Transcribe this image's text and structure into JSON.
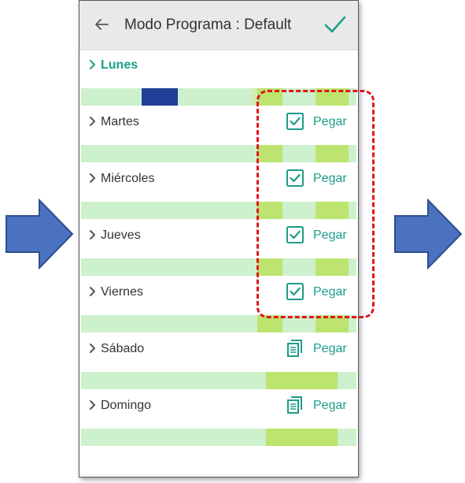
{
  "header": {
    "title": "Modo Programa : Default",
    "back_icon": "arrow-left-icon",
    "confirm_icon": "check-icon"
  },
  "days": [
    {
      "label": "Lunes",
      "active": true,
      "paste": null,
      "segments": [
        {
          "start": 0.62,
          "end": 0.72,
          "color": "#d0ecb0"
        },
        {
          "start": 0.22,
          "end": 0.35,
          "color": "#1f3f96"
        },
        {
          "start": 0.64,
          "end": 0.73,
          "color": "#bde46e"
        },
        {
          "start": 0.85,
          "end": 0.97,
          "color": "#bde46e"
        }
      ]
    },
    {
      "label": "Martes",
      "active": false,
      "paste": {
        "icon": "checkbox-checked-icon",
        "label": "Pegar"
      },
      "segments": [
        {
          "start": 0.64,
          "end": 0.73,
          "color": "#bde46e"
        },
        {
          "start": 0.85,
          "end": 0.97,
          "color": "#bde46e"
        }
      ]
    },
    {
      "label": "Miércoles",
      "active": false,
      "paste": {
        "icon": "checkbox-checked-icon",
        "label": "Pegar"
      },
      "segments": [
        {
          "start": 0.64,
          "end": 0.73,
          "color": "#bde46e"
        },
        {
          "start": 0.85,
          "end": 0.97,
          "color": "#bde46e"
        }
      ]
    },
    {
      "label": "Jueves",
      "active": false,
      "paste": {
        "icon": "checkbox-checked-icon",
        "label": "Pegar"
      },
      "segments": [
        {
          "start": 0.64,
          "end": 0.73,
          "color": "#bde46e"
        },
        {
          "start": 0.85,
          "end": 0.97,
          "color": "#bde46e"
        }
      ]
    },
    {
      "label": "Viernes",
      "active": false,
      "paste": {
        "icon": "checkbox-checked-icon",
        "label": "Pegar"
      },
      "segments": [
        {
          "start": 0.64,
          "end": 0.73,
          "color": "#bde46e"
        },
        {
          "start": 0.85,
          "end": 0.97,
          "color": "#bde46e"
        }
      ]
    },
    {
      "label": "Sábado",
      "active": false,
      "paste": {
        "icon": "copy-icon",
        "label": "Pegar"
      },
      "segments": [
        {
          "start": 0.67,
          "end": 0.93,
          "color": "#bde46e"
        }
      ]
    },
    {
      "label": "Domingo",
      "active": false,
      "paste": {
        "icon": "copy-icon",
        "label": "Pegar"
      },
      "segments": [
        {
          "start": 0.67,
          "end": 0.93,
          "color": "#bde46e"
        }
      ]
    }
  ],
  "colors": {
    "accent": "#17a08a",
    "bar_background": "#cdf1cc",
    "segment_light": "#bde46e",
    "segment_dark": "#1f3f96",
    "highlight_dash": "#e0161d",
    "arrow_fill": "#4a72c0"
  }
}
